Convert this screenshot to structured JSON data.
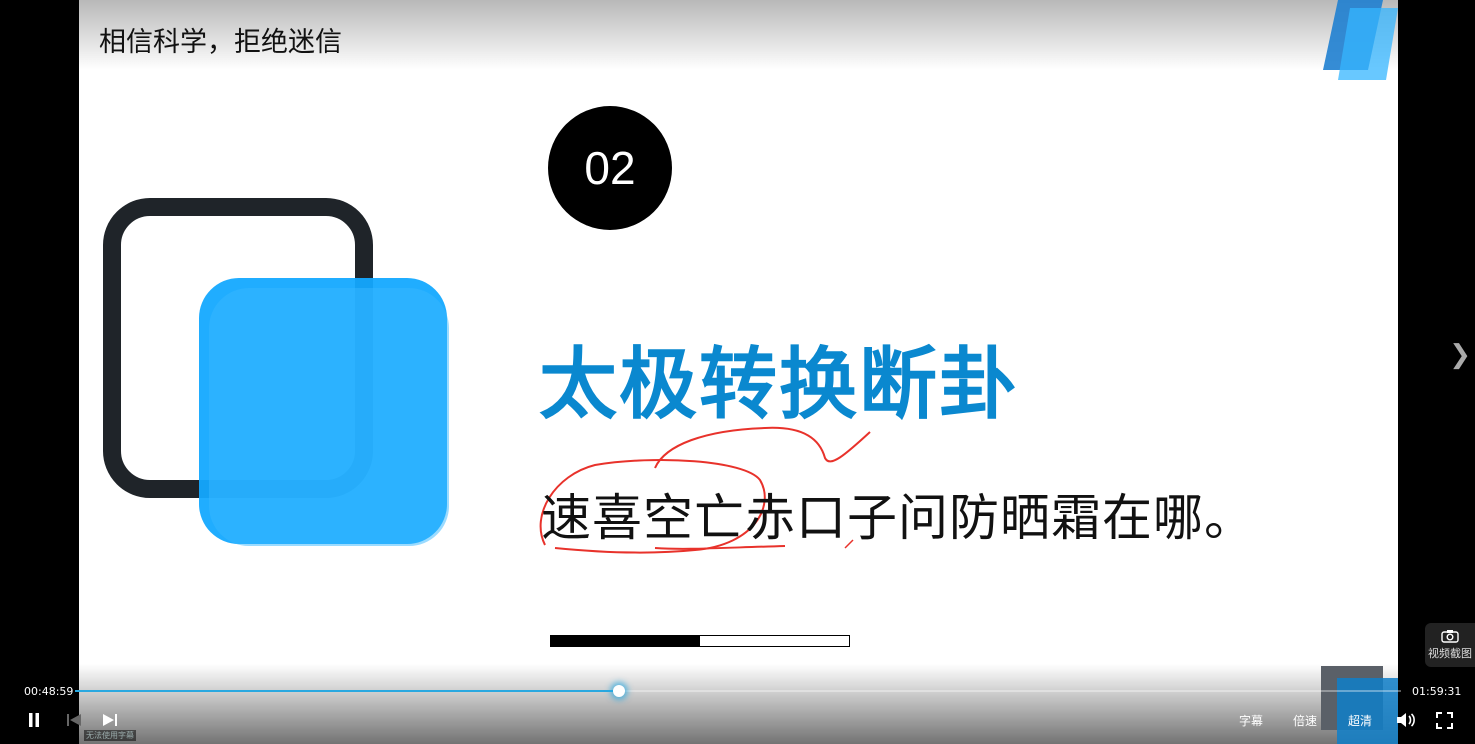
{
  "video": {
    "title": "相信科学，拒绝迷信"
  },
  "slide": {
    "number": "02",
    "headline": "太极转换断卦",
    "subline": "速喜空亡赤口子问防晒霜在哪。",
    "section_progress": 0.5,
    "colors": {
      "accent_blue": "#0a88cf",
      "square_blue": "#14a9ff",
      "square_dark": "#1f2429",
      "annotation_red": "#e8322b"
    }
  },
  "player": {
    "current_time": "00:48:59",
    "total_time": "01:59:31",
    "progress": 0.41,
    "tooltip": "无法使用字幕",
    "subtitle_label": "字幕",
    "speed_label": "倍速",
    "quality_label": "超清",
    "snapshot_label": "视频截图",
    "icons": {
      "pause": "pause-icon",
      "prev": "skip-previous-icon",
      "next": "skip-next-icon",
      "volume": "volume-icon",
      "fullscreen": "fullscreen-icon",
      "camera": "camera-icon",
      "next_video": "chevron-right-icon"
    }
  }
}
